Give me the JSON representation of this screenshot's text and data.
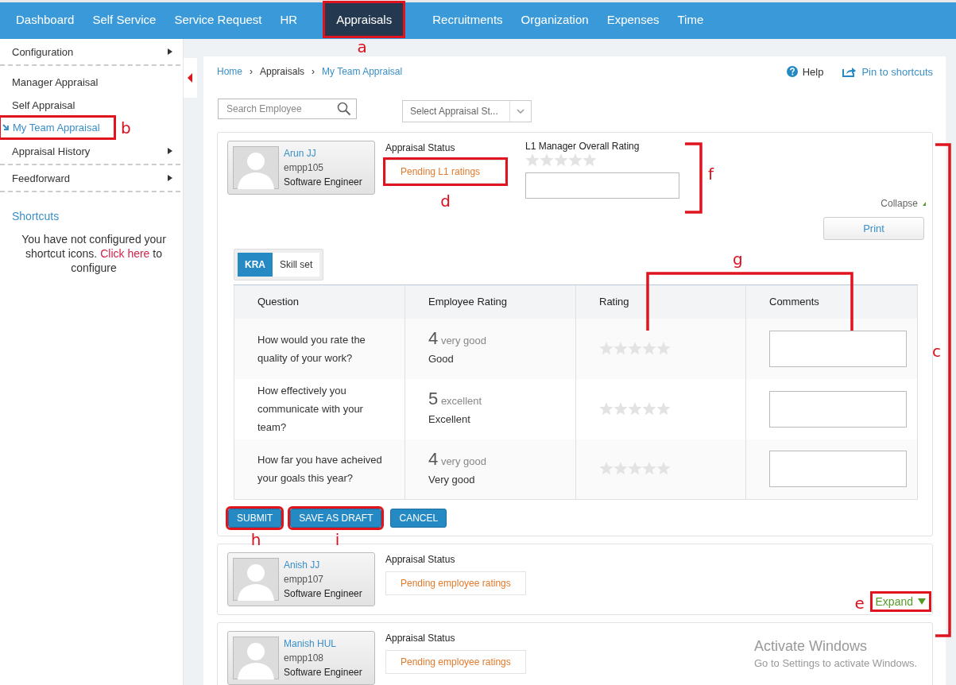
{
  "nav": {
    "items": [
      {
        "label": "Dashboard",
        "selected": false
      },
      {
        "label": "Self Service",
        "selected": false
      },
      {
        "label": "Service Request",
        "selected": false
      },
      {
        "label": "HR",
        "selected": false
      },
      {
        "label": "Appraisals",
        "selected": true,
        "annotation": "a"
      },
      {
        "label": "Recruitments",
        "selected": false
      },
      {
        "label": "Organization",
        "selected": false
      },
      {
        "label": "Expenses",
        "selected": false
      },
      {
        "label": "Time",
        "selected": false
      }
    ]
  },
  "sidebar": {
    "items": [
      {
        "label": "Configuration",
        "selected": false,
        "has_submenu": true
      },
      {
        "label": "Manager Appraisal",
        "selected": false,
        "has_submenu": false
      },
      {
        "label": "Self Appraisal",
        "selected": false,
        "has_submenu": false
      },
      {
        "label": "My Team Appraisal",
        "selected": true,
        "has_submenu": false,
        "annotation": "b"
      },
      {
        "label": "Appraisal History",
        "selected": false,
        "has_submenu": true
      },
      {
        "label": "Feedforward",
        "selected": false,
        "has_submenu": true
      }
    ],
    "shortcuts": {
      "title": "Shortcuts",
      "message": "You have not configured your shortcut icons.",
      "link": "Click here",
      "message_end": "to configure"
    }
  },
  "breadcrumb": {
    "separator": "›",
    "items": [
      {
        "label": "Home",
        "link": true
      },
      {
        "label": "Appraisals",
        "link": false
      },
      {
        "label": "My Team Appraisal",
        "link": true
      }
    ]
  },
  "help": "Help",
  "pin": "Pin to shortcuts",
  "search": {
    "placeholder": "Search Employee"
  },
  "status_filter": {
    "placeholder": "Select Appraisal St..."
  },
  "cards": [
    {
      "name": "Arun JJ",
      "code": "empp105",
      "title": "Software Engineer",
      "status_label": "Appraisal Status",
      "status": "Pending L1 ratings",
      "status_annotation": "d",
      "expanded": true,
      "toggle": "Collapse",
      "overall": {
        "label": "L1 Manager Overall Rating",
        "stars": 0
      },
      "print": "Print",
      "tabs": [
        {
          "label": "KRA",
          "selected": true
        },
        {
          "label": "Skill set",
          "selected": false
        }
      ],
      "table": {
        "columns": [
          "Question",
          "Employee Rating",
          "Rating",
          "Comments"
        ],
        "rows": [
          {
            "question": "How would you rate the quality of your work?",
            "score": "4",
            "score_text": "very good",
            "employee_comment": "Good",
            "stars": 0
          },
          {
            "question": "How effectively you communicate with your team?",
            "score": "5",
            "score_text": "excellent",
            "employee_comment": "Excellent",
            "stars": 0
          },
          {
            "question": "How far you have acheived your goals this year?",
            "score": "4",
            "score_text": "very good",
            "employee_comment": "Very good",
            "stars": 0
          }
        ]
      },
      "buttons": [
        {
          "label": "SUBMIT",
          "annotation": "h"
        },
        {
          "label": "SAVE AS DRAFT",
          "annotation": "i"
        },
        {
          "label": "CANCEL"
        }
      ]
    },
    {
      "name": "Anish JJ",
      "code": "empp107",
      "title": "Software Engineer",
      "status_label": "Appraisal Status",
      "status": "Pending employee ratings",
      "expanded": false,
      "toggle": "Expand",
      "toggle_annotation": "e"
    },
    {
      "name": "Manish HUL",
      "code": "empp108",
      "title": "Software Engineer",
      "status_label": "Appraisal Status",
      "status": "Pending employee ratings",
      "expanded": false
    }
  ],
  "brackets": [
    {
      "label": "c"
    },
    {
      "label": "f"
    },
    {
      "label": "g"
    }
  ],
  "os_notice": {
    "title": "Activate Windows",
    "message": "Go to Settings to activate Windows."
  }
}
